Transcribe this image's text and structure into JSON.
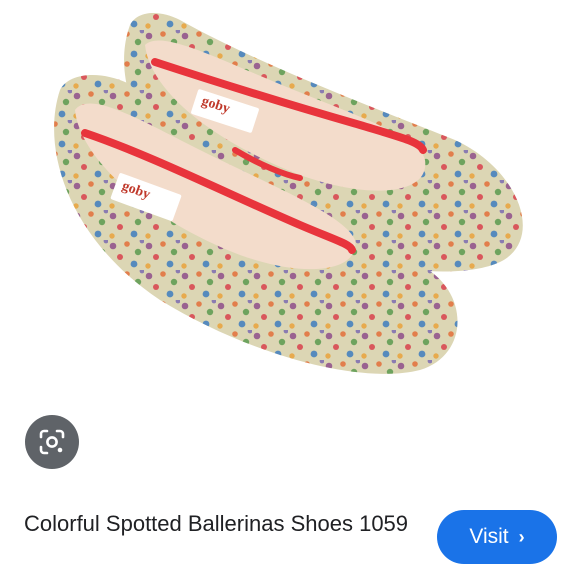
{
  "product": {
    "title": "Colorful Spotted Ballerinas Shoes 1059",
    "image_alt": "Colorful spotted ballerina flats",
    "brand_label": "goby"
  },
  "actions": {
    "visit_label": "Visit",
    "visit_icon": "chevron-right-icon",
    "lens_icon": "google-lens-icon"
  },
  "colors": {
    "visit_bg": "#1a73e8",
    "lens_bg": "#5f6368",
    "shoe_upper": "#dcd6b4",
    "shoe_lining": "#f3dccb",
    "trim": "#e8343c"
  }
}
